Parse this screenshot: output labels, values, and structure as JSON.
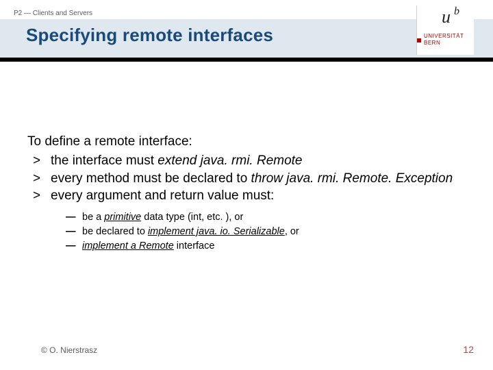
{
  "header": {
    "course": "P2 — Clients and Servers"
  },
  "title": "Specifying remote interfaces",
  "logo": {
    "u": "u",
    "b": "b",
    "uni": "UNIVERSITÄT",
    "bern": "BERN"
  },
  "content": {
    "lead": "To define a remote interface:",
    "bullets": [
      {
        "pre": "the interface must ",
        "em": "extend java. rmi. Remote",
        "post": ""
      },
      {
        "pre": "every method must be declared to ",
        "em": "throw java. rmi. Remote. Exception",
        "post": ""
      },
      {
        "pre": "every argument and return value must:",
        "em": "",
        "post": ""
      }
    ],
    "subs": [
      {
        "pre": "be a ",
        "u": "primitive",
        "post": " data type (int, etc. ), or"
      },
      {
        "pre": "be declared to ",
        "u": "implement java. io. Serializable",
        "post": ", or"
      },
      {
        "pre": "",
        "u": "implement a Remote",
        "post": " interface"
      }
    ]
  },
  "footer": {
    "copyright": "© O. Nierstrasz",
    "page": "12"
  }
}
